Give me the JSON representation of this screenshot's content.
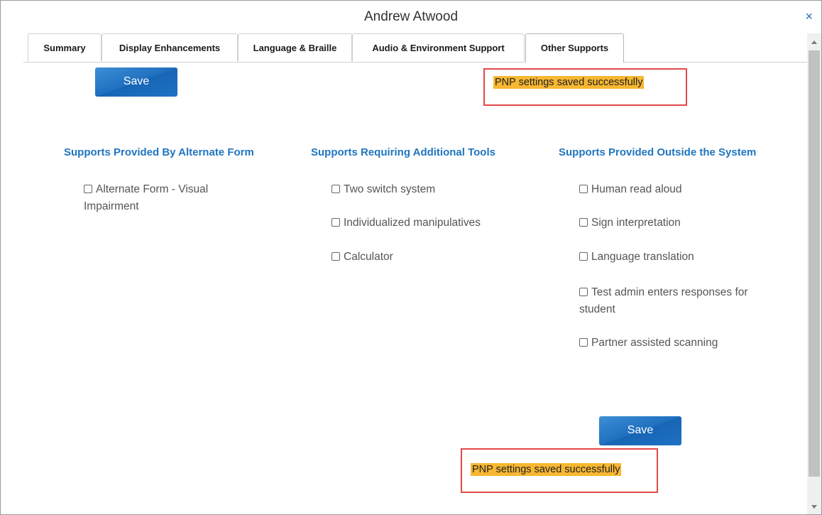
{
  "dialog": {
    "title": "Andrew Atwood",
    "close_label": "×"
  },
  "tabs": [
    {
      "label": "Summary",
      "active": false
    },
    {
      "label": "Display Enhancements",
      "active": false
    },
    {
      "label": "Language & Braille",
      "active": false
    },
    {
      "label": "Audio & Environment Support",
      "active": false
    },
    {
      "label": "Other Supports",
      "active": true
    }
  ],
  "actions": {
    "save_label": "Save",
    "status_message": "PNP settings saved successfully"
  },
  "columns": [
    {
      "heading": "Supports Provided By Alternate Form",
      "options": [
        {
          "line1": "Alternate Form - Visual",
          "line2": "Impairment",
          "checked": false
        }
      ]
    },
    {
      "heading": "Supports Requiring Additional Tools",
      "options": [
        {
          "line1": "Two switch system",
          "checked": false
        },
        {
          "line1": "Individualized manipulatives",
          "checked": false
        },
        {
          "line1": "Calculator",
          "checked": false
        }
      ]
    },
    {
      "heading": "Supports Provided Outside the System",
      "options": [
        {
          "line1": "Human read aloud",
          "checked": false
        },
        {
          "line1": "Sign interpretation",
          "checked": false
        },
        {
          "line1": "Language translation",
          "checked": false
        },
        {
          "line1": "Test admin enters responses for",
          "line2": "student",
          "checked": false
        },
        {
          "line1": "Partner assisted scanning",
          "checked": false
        }
      ]
    }
  ],
  "colors": {
    "accent": "#2075c0",
    "button": "#1f6fbf",
    "highlight": "#f7b731",
    "alert_border": "#e34848"
  }
}
